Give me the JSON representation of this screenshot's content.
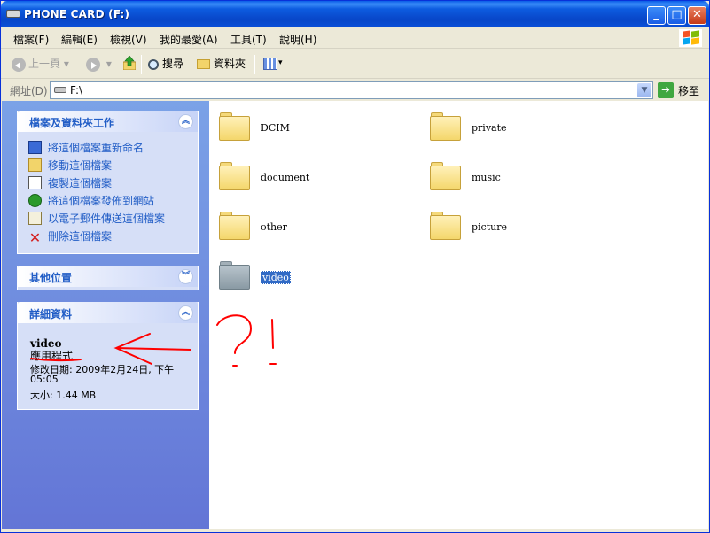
{
  "window": {
    "title": "PHONE CARD (F:)"
  },
  "menu": [
    "檔案(F)",
    "編輯(E)",
    "檢視(V)",
    "我的最愛(A)",
    "工具(T)",
    "說明(H)"
  ],
  "toolbar": {
    "back": "上一頁",
    "search": "搜尋",
    "folders": "資料夾"
  },
  "address": {
    "label": "網址(D)",
    "value": "F:\\",
    "go": "移至"
  },
  "tasks": {
    "title": "檔案及資料夾工作",
    "items": [
      {
        "label": "將這個檔案重新命名",
        "icon": "rename-icon"
      },
      {
        "label": "移動這個檔案",
        "icon": "move-icon"
      },
      {
        "label": "複製這個檔案",
        "icon": "copy-icon"
      },
      {
        "label": "將這個檔案發佈到網站",
        "icon": "publish-web-icon"
      },
      {
        "label": "以電子郵件傳送這個檔案",
        "icon": "email-icon"
      },
      {
        "label": "刪除這個檔案",
        "icon": "delete-icon"
      }
    ]
  },
  "other_places": {
    "title": "其他位置"
  },
  "details": {
    "title": "詳細資料",
    "name": "video",
    "type": "應用程式",
    "modified_1": "修改日期: 2009年2月24日, 下午",
    "modified_2": "05:05",
    "size": "大小: 1.44 MB"
  },
  "files": [
    {
      "name": "DCIM",
      "color": "yellow"
    },
    {
      "name": "private",
      "color": "yellow"
    },
    {
      "name": "document",
      "color": "yellow"
    },
    {
      "name": "music",
      "color": "yellow"
    },
    {
      "name": "other",
      "color": "yellow"
    },
    {
      "name": "picture",
      "color": "yellow"
    },
    {
      "name": "video",
      "color": "grey",
      "selected": true
    }
  ],
  "colors": {
    "taskpane_top": "#7ba2e7",
    "taskpane_bottom": "#6375d6",
    "link": "#215dc6",
    "selection": "#316ac5",
    "annotation": "#ff0000"
  }
}
